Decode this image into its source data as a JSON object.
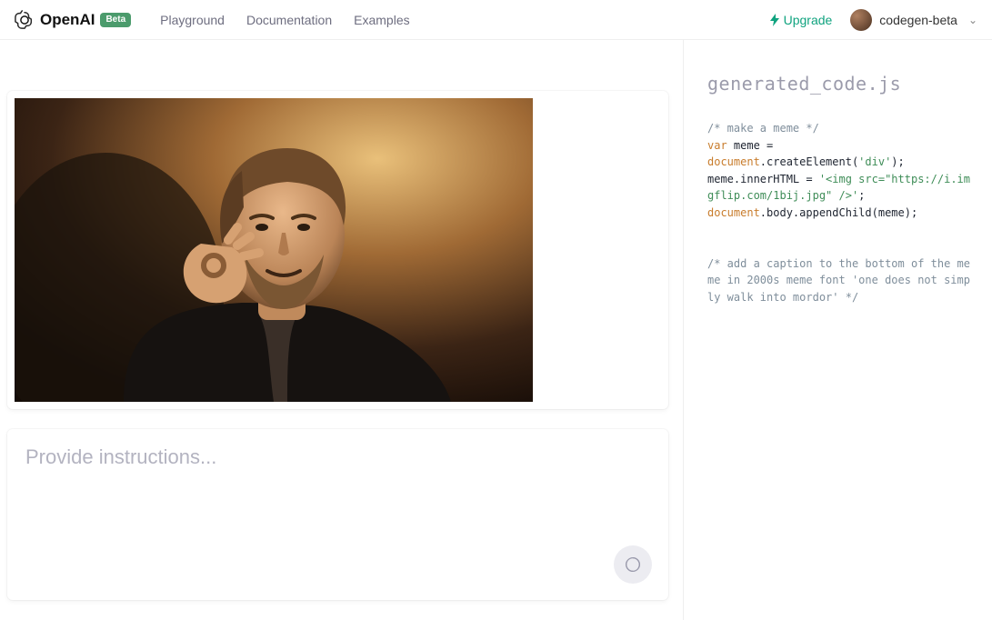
{
  "header": {
    "brand": "OpenAI",
    "badge": "Beta",
    "nav": [
      "Playground",
      "Documentation",
      "Examples"
    ],
    "upgrade": "Upgrade",
    "username": "codegen-beta"
  },
  "instructions": {
    "placeholder": "Provide instructions..."
  },
  "code": {
    "filename": "generated_code.js",
    "comment1": "/* make a meme */",
    "kw_var": "var",
    "decl": " meme = ",
    "id_doc1": "document",
    "call_create": ".createElement(",
    "str_div": "'div'",
    "close_create": ");",
    "line_inner": "meme.innerHTML = ",
    "str_inner": "'<img src=\"https://i.imgflip.com/1bij.jpg\" />'",
    "semi": ";",
    "id_doc2": "document",
    "append": ".body.appendChild(meme);",
    "comment2": "/* add a caption to the bottom of the meme in 2000s meme font 'one does not simply walk into mordor' */"
  }
}
